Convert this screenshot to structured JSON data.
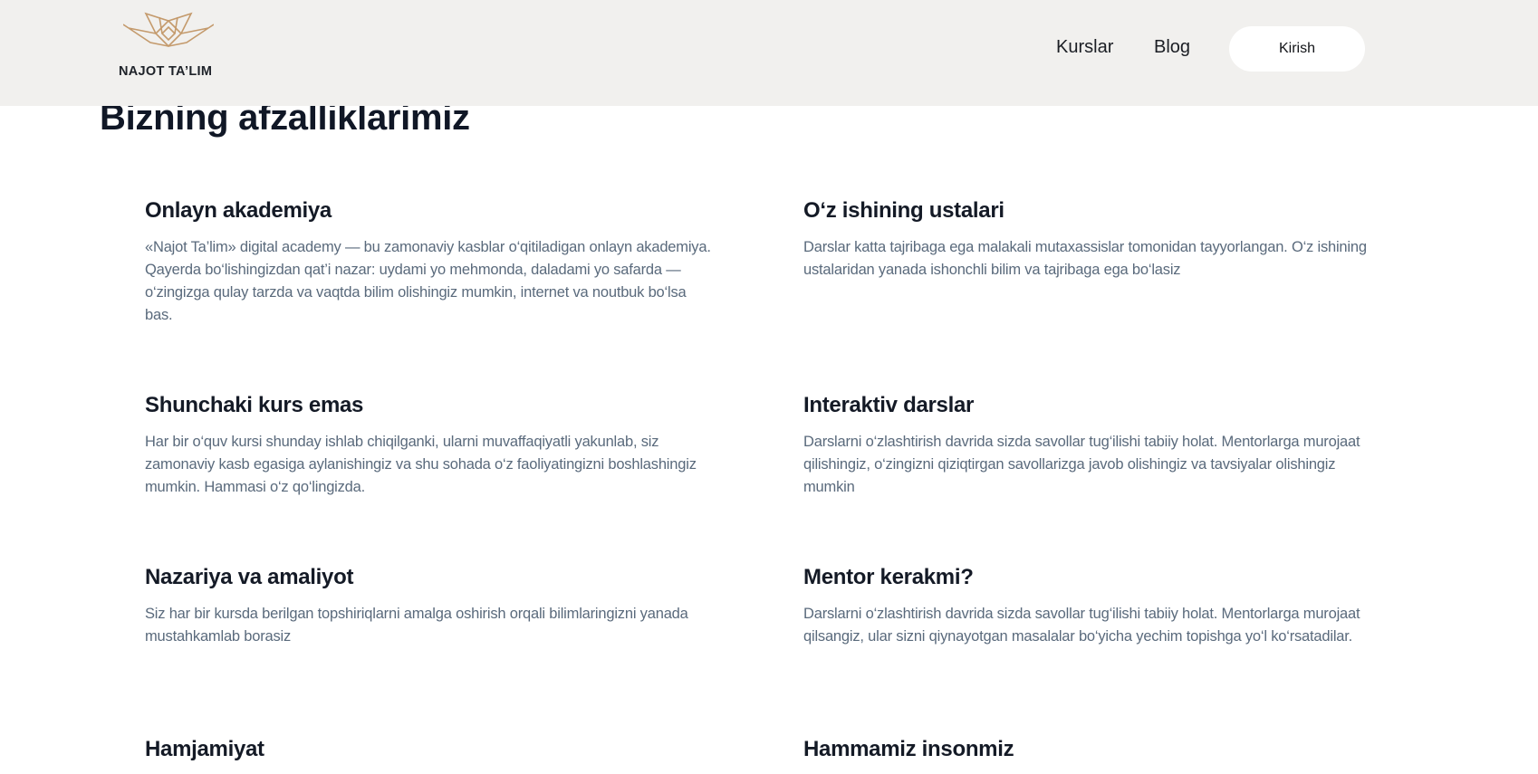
{
  "header": {
    "logo_text": "NAJOT TA’LIM",
    "logo_color": "#c49a6c",
    "nav": [
      {
        "label": "Kurslar"
      },
      {
        "label": "Blog"
      }
    ],
    "login_label": "Kirish",
    "background": "#f1f0ee"
  },
  "main": {
    "title": "Bizning afzalliklarimiz",
    "features": [
      {
        "title": "Onlayn akademiya",
        "text": "«Najot Ta’lim» digital academy — bu zamonaviy kasblar o‘qitiladigan onlayn akademiya. Qayerda bo‘lishingizdan qat’i nazar: uydami yo mehmonda, daladami yo safarda — o‘zingizga qulay tarzda va vaqtda bilim olishingiz mumkin, internet va noutbuk bo‘lsa bas."
      },
      {
        "title": "O‘z ishining ustalari",
        "text": "Darslar katta tajribaga ega malakali mutaxassislar tomonidan tayyorlangan. O‘z ishining ustalaridan yanada ishonchli bilim va tajribaga ega bo‘lasiz"
      },
      {
        "title": "Shunchaki kurs emas",
        "text": "Har bir o‘quv kursi shunday ishlab chiqilganki, ularni muvaffaqiyatli yakunlab, siz zamonaviy kasb egasiga aylanishingiz va shu sohada o‘z faoliyatingizni boshlashingiz mumkin. Hammasi o‘z qo‘lingizda."
      },
      {
        "title": "Interaktiv darslar",
        "text": "Darslarni o‘zlashtirish davrida sizda savollar tug‘ilishi tabiiy holat. Mentorlarga murojaat qilishingiz, o‘zingizni qiziqtirgan savollarizga javob olishingiz va tavsiyalar olishingiz mumkin"
      },
      {
        "title": "Nazariya va amaliyot",
        "text": "Siz har bir kursda berilgan topshiriqlarni amalga oshirish orqali bilimlaringizni yanada mustahkamlab borasiz"
      },
      {
        "title": "Mentor kerakmi?",
        "text": "Darslarni o‘zlashtirish davrida sizda savollar tug‘ilishi tabiiy holat. Mentorlarga murojaat qilsangiz, ular sizni qiynayotgan masalalar bo‘yicha yechim topishga yo‘l ko‘rsatadilar."
      },
      {
        "title": "Hamjamiyat",
        "text": ""
      },
      {
        "title": "Hammamiz insonmiz",
        "text": ""
      }
    ]
  }
}
